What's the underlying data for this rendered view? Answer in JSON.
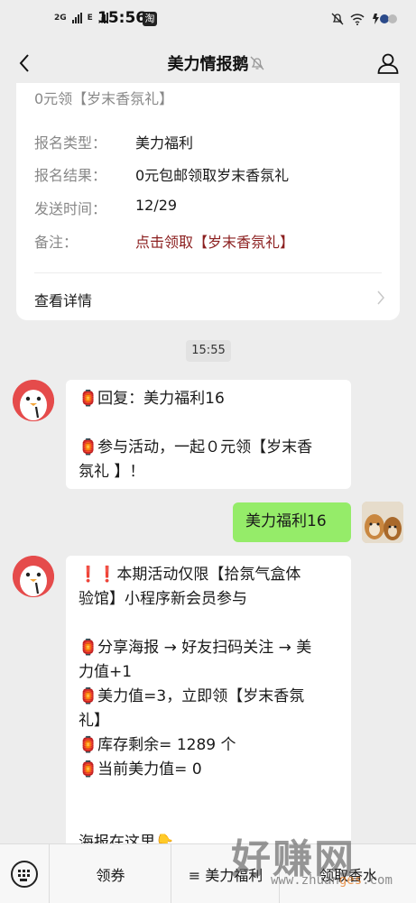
{
  "status_bar": {
    "net1": "2G",
    "net2": "E",
    "time": "15:56",
    "badge": "淘"
  },
  "nav": {
    "title": "美力情报鹅"
  },
  "card": {
    "header": "0元领【岁末香氛礼】",
    "rows": [
      {
        "key": "报名类型：",
        "value": "美力福利"
      },
      {
        "key": "报名结果：",
        "value": "0元包邮领取岁末香氛礼"
      },
      {
        "key": "发送时间：",
        "value": "12/29"
      },
      {
        "key": "备注：",
        "value": "点击领取【岁末香氛礼】"
      }
    ],
    "detail_label": "查看详情"
  },
  "timestamp": "15:55",
  "messages": {
    "bot1_line1": "🏮回复：美力福利16",
    "bot1_line2": "🏮参与活动，一起０元领【岁末香",
    "bot1_line3": "氛礼 】！",
    "user1": "美力福利16",
    "bot2_lines": [
      "❗❗本期活动仅限【拾氛气盒体",
      "验馆】小程序新会员参与",
      "",
      "🏮分享海报 → 好友扫码关注 → 美",
      "力值+1",
      "🏮美力值=3，立即领【岁末香氛",
      "礼】",
      "🏮库存剩余=  1289 个",
      "🏮当前美力值= 0",
      "",
      "",
      "海报在这里👇"
    ]
  },
  "bottom_bar": {
    "tab1": "领券",
    "tab2": "≡ 美力福利",
    "tab3": "领取香水"
  },
  "watermark": {
    "big": "好赚网",
    "small_prefix": "www.zhuan",
    "small_mid": "ges",
    "small_suffix": ".com"
  },
  "colors": {
    "background": "#ededed",
    "bubble_green": "#95ec69",
    "remark_red": "#8b1e1e",
    "bot_avatar": "#e54b4b"
  }
}
